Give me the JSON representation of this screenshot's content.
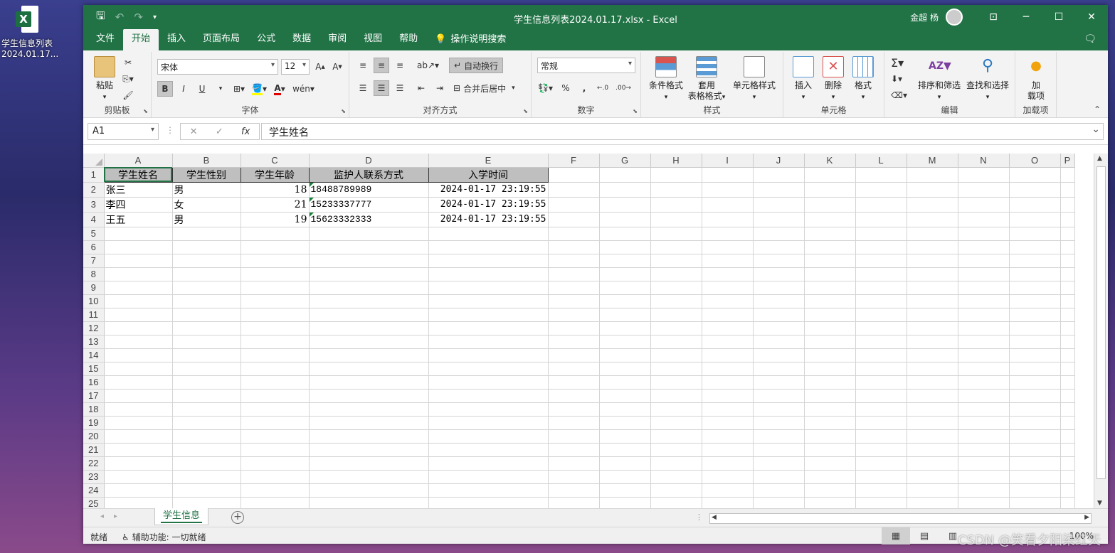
{
  "desktop": {
    "icon_label": "学生信息列表2024.01.17..."
  },
  "window": {
    "title": "学生信息列表2024.01.17.xlsx  -  Excel",
    "user_name": "金超 杨"
  },
  "ribbon_tabs": [
    "文件",
    "开始",
    "插入",
    "页面布局",
    "公式",
    "数据",
    "审阅",
    "视图",
    "帮助"
  ],
  "tell_me": "操作说明搜索",
  "ribbon": {
    "clipboard": {
      "label": "剪贴板",
      "paste": "粘贴"
    },
    "font": {
      "label": "字体",
      "font_name": "宋体",
      "font_size": "12",
      "bold": "B",
      "italic": "I",
      "underline": "U"
    },
    "alignment": {
      "label": "对齐方式",
      "wrap": "自动换行",
      "merge": "合并后居中"
    },
    "number": {
      "label": "数字",
      "format": "常规",
      "percent": "%",
      "comma": ","
    },
    "styles": {
      "label": "样式",
      "cond": "条件格式",
      "table_1": "套用",
      "table_2": "表格格式",
      "cell": "单元格样式"
    },
    "cells": {
      "label": "单元格",
      "insert": "插入",
      "delete": "删除",
      "format": "格式"
    },
    "editing": {
      "label": "编辑",
      "sort": "排序和筛选",
      "find": "查找和选择"
    },
    "addins": {
      "label": "加载项",
      "btn_1": "加",
      "btn_2": "载项"
    }
  },
  "formula_bar": {
    "name_box": "A1",
    "fx": "fx",
    "content": "学生姓名"
  },
  "columns": [
    "A",
    "B",
    "C",
    "D",
    "E",
    "F",
    "G",
    "H",
    "I",
    "J",
    "K",
    "L",
    "M",
    "N",
    "O",
    "P"
  ],
  "table": {
    "headers": [
      "学生姓名",
      "学生性别",
      "学生年龄",
      "监护人联系方式",
      "入学时间"
    ],
    "rows": [
      [
        "张三",
        "男",
        "18",
        "18488789989",
        "2024-01-17 23:19:55"
      ],
      [
        "李四",
        "女",
        "21",
        "15233337777",
        "2024-01-17 23:19:55"
      ],
      [
        "王五",
        "男",
        "19",
        "15623332333",
        "2024-01-17 23:19:55"
      ]
    ]
  },
  "row_count": 25,
  "sheet_tab": "学生信息",
  "status": {
    "ready": "就绪",
    "accessibility": "辅助功能: 一切就绪",
    "zoom": "100%"
  },
  "watermark": "CSDN @笑看夕阳染红天"
}
